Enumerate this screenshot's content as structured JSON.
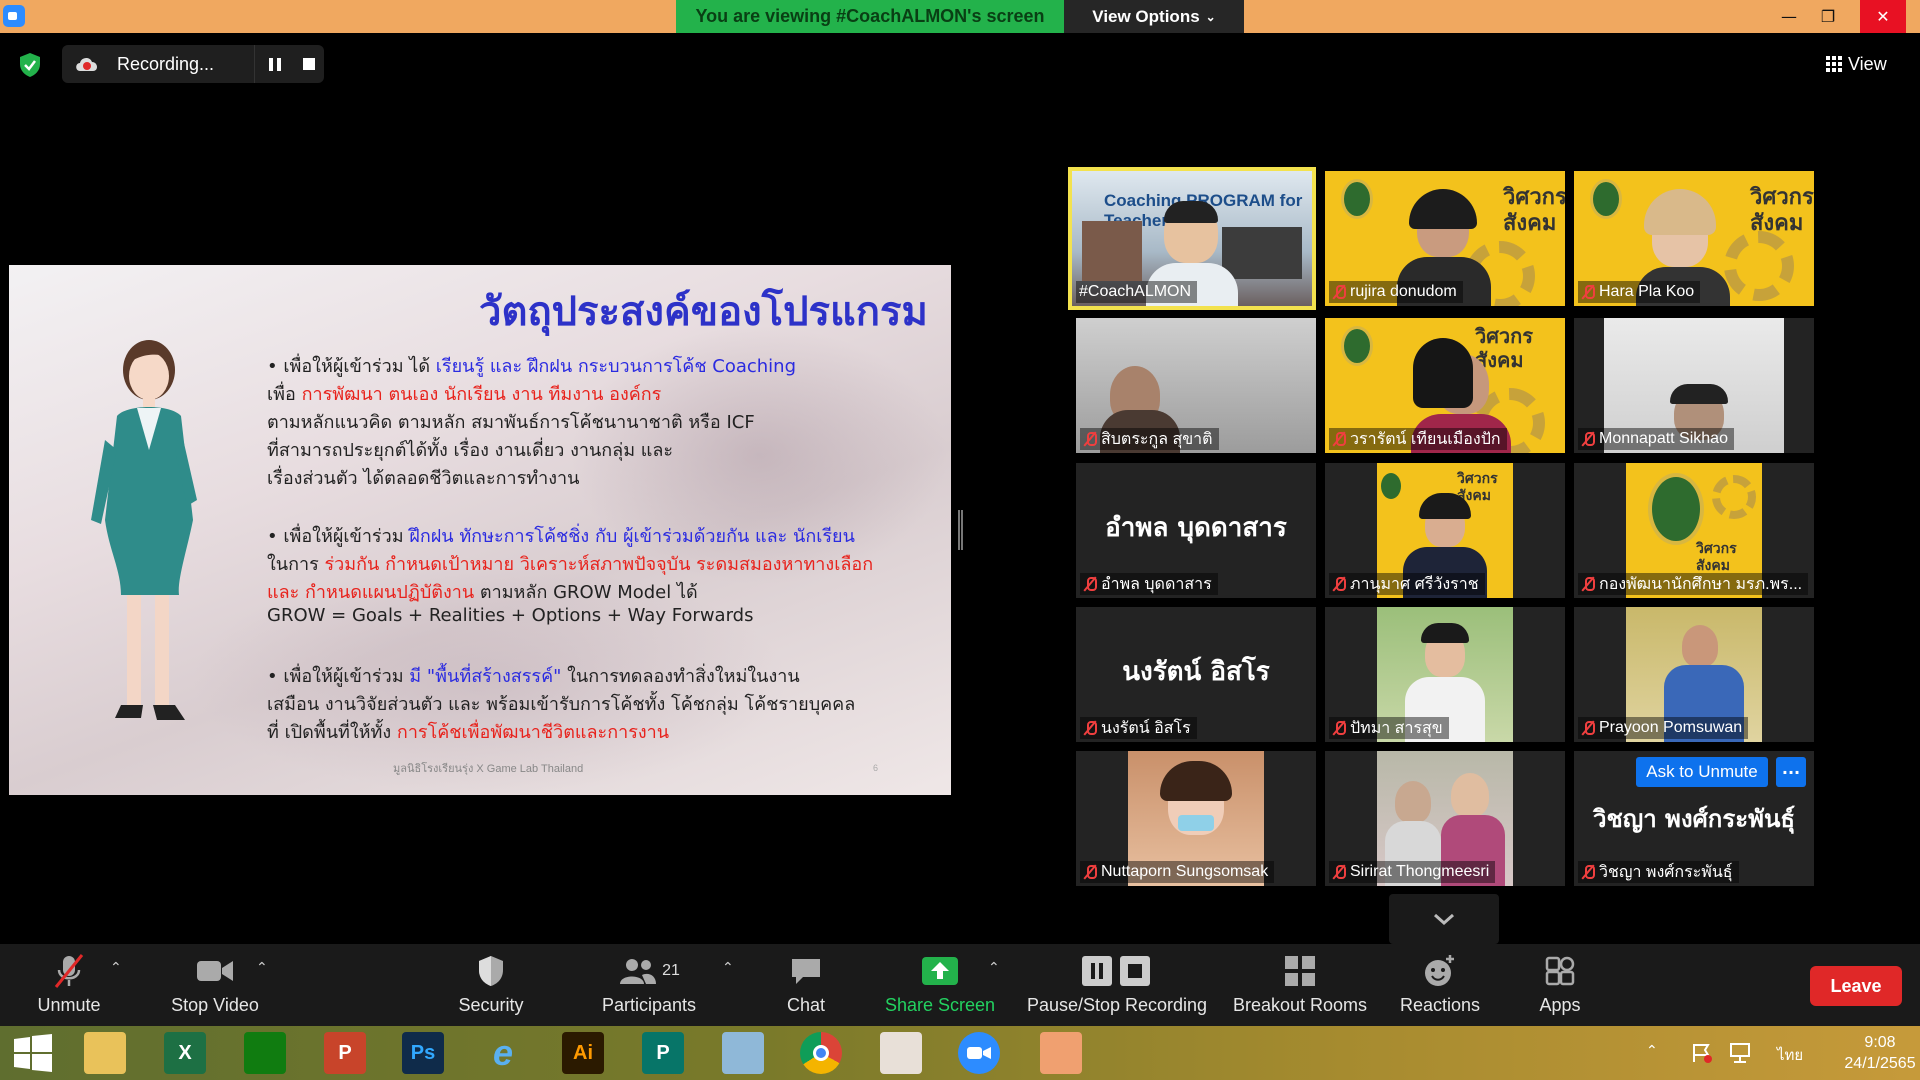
{
  "titlebar": {
    "viewing_text": "You are viewing #CoachALMON's screen",
    "view_options_label": "View Options",
    "minimize_glyph": "—",
    "restore_glyph": "❐",
    "close_glyph": "✕"
  },
  "recording": {
    "label": "Recording..."
  },
  "view_button": {
    "label": "View"
  },
  "slide": {
    "title": "วัตถุประสงค์ของโปรแกรม",
    "b1_l1_a": "• เพื่อให้ผู้เข้าร่วม ได้ ",
    "b1_l1_b": "เรียนรู้ และ ฝึกฝน กระบวนการโค้ช Coaching",
    "b1_l2_a": "เพื่อ ",
    "b1_l2_b": "การพัฒนา ตนเอง นักเรียน งาน ทีมงาน องค์กร",
    "b1_l3": "ตามหลักแนวคิด ตามหลัก สมาพันธ์การโค้ชนานาชาติ หรือ ICF",
    "b1_l4": "ที่สามารถประยุกต์ได้ทั้ง เรื่อง งานเดี่ยว งานกลุ่ม และ",
    "b1_l5": "เรื่องส่วนตัว ได้ตลอดชีวิตและการทำงาน",
    "b2_l1_a": "• เพื่อให้ผู้เข้าร่วม ",
    "b2_l1_b": "ฝึกฝน ทักษะการโค้ชชิ่ง กับ ผู้เข้าร่วมด้วยกัน และ นักเรียน",
    "b2_l2_a": "ในการ ",
    "b2_l2_b": "ร่วมกัน กำหนดเป้าหมาย วิเคราะห์สภาพปัจจุบัน ระดมสมองหาทางเลือก",
    "b2_l3_a": "และ กำหนดแผนปฏิบัติงาน",
    "b2_l3_b": " ตามหลัก GROW Model ได้",
    "b2_l4": "GROW = Goals + Realities + Options + Way Forwards",
    "b3_l1_a": "• เพื่อให้ผู้เข้าร่วม ",
    "b3_l1_b": "มี \"พื้นที่สร้างสรรค์\"",
    "b3_l1_c": " ในการทดลองทำสิ่งใหม่ในงาน",
    "b3_l2": "เสมือน งานวิจัยส่วนตัว และ พร้อมเข้ารับการโค้ชทั้ง โค้ชกลุ่ม โค้ชรายบุคคล",
    "b3_l3_a": "ที่ เปิดพื้นที่ให้ทั้ง ",
    "b3_l3_b": "การโค้ชเพื่อพัฒนาชีวิตและการงาน",
    "footer": "มูลนิธิโรงเรียนรุ่ง X Game Lab Thailand",
    "page": "6"
  },
  "gallery": [
    {
      "name": "#CoachALMON",
      "muted": false,
      "poster_text": "Coaching PROGRAM for Teacher"
    },
    {
      "name": "rujira donudom",
      "muted": true,
      "poster_text": "วิศวกรสังคม"
    },
    {
      "name": "Hara Pla Koo",
      "muted": true,
      "poster_text": "วิศวกรสังคม"
    },
    {
      "name": "สิบตระกูล สุขาติ",
      "muted": true
    },
    {
      "name": "วรารัตน์ เทียนเมืองปัก",
      "muted": true,
      "poster_text": "วิศวกรสังคม"
    },
    {
      "name": "Monnapatt Sikhao",
      "muted": true
    },
    {
      "name": "อำพล บุดดาสาร",
      "muted": true,
      "big_name": "อำพล บุดดาสาร"
    },
    {
      "name": "ภานุมาศ ศรีวังราช",
      "muted": true,
      "poster_text": "วิศวกรสังคม"
    },
    {
      "name": "กองพัฒนานักศึกษา มรภ.พร...",
      "muted": true,
      "poster_text": "วิศวกรสังคม"
    },
    {
      "name": "นงรัตน์ อิสโร",
      "muted": true,
      "big_name": "นงรัตน์ อิสโร"
    },
    {
      "name": "ปัทมา สารสุข",
      "muted": true
    },
    {
      "name": "Prayoon Pomsuwan",
      "muted": true
    },
    {
      "name": "Nuttaporn Sungsomsak",
      "muted": true
    },
    {
      "name": "Sirirat Thongmeesri",
      "muted": true
    },
    {
      "name": "วิชญา พงศ์กระพันธุ์",
      "muted": true,
      "big_name": "วิชญา พงศ์กระพันธุ์"
    }
  ],
  "hover_actions": {
    "ask_unmute_label": "Ask to Unmute",
    "more_label": "···"
  },
  "toolbar": {
    "unmute_label": "Unmute",
    "stop_video_label": "Stop Video",
    "security_label": "Security",
    "participants_label": "Participants",
    "participants_count": "21",
    "chat_label": "Chat",
    "share_screen_label": "Share Screen",
    "pause_stop_recording_label": "Pause/Stop Recording",
    "breakout_rooms_label": "Breakout Rooms",
    "reactions_label": "Reactions",
    "apps_label": "Apps",
    "leave_label": "Leave",
    "caret_glyph": "⌃"
  },
  "taskbar": {
    "apps": [
      "Windows Start",
      "File Explorer",
      "Excel",
      "Store",
      "PowerPoint",
      "Photoshop",
      "Internet Explorer",
      "Illustrator",
      "Publisher",
      "Notepad",
      "Chrome",
      "Paint",
      "Zoom",
      "Camera"
    ],
    "excel_letter": "X",
    "ppt_letter": "P",
    "ps_letter": "Ps",
    "ai_letter": "Ai",
    "pub_letter": "P",
    "ie_letter": "e",
    "language": "ไทย",
    "time": "9:08",
    "date": "24/1/2565"
  },
  "colors": {
    "accent_blue": "#0e72ed",
    "share_green": "#23d160",
    "leave_red": "#e02828",
    "banner_green": "#23b24b",
    "speaker_outline": "#f3e24e"
  }
}
